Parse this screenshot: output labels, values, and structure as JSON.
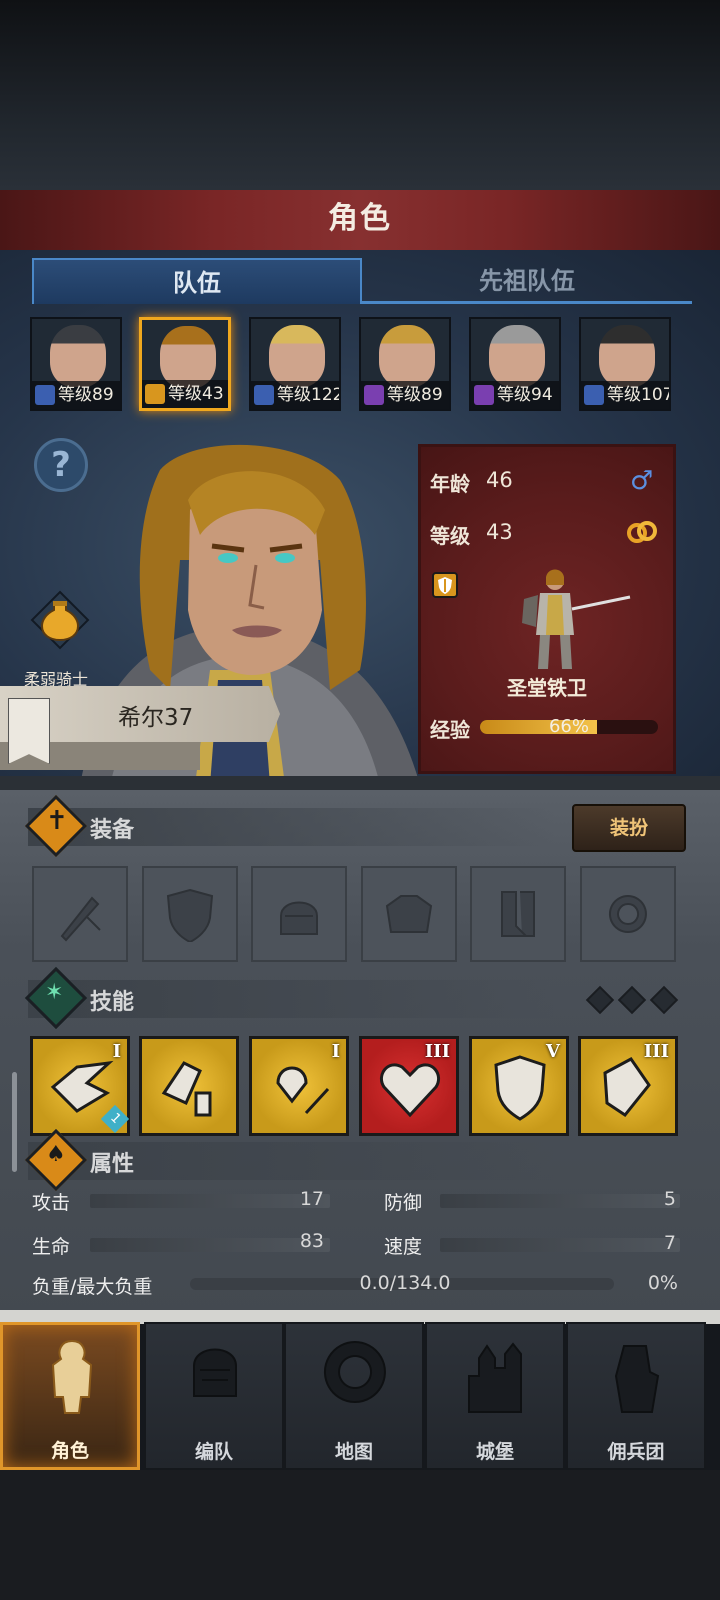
{
  "header": {
    "title": "角色"
  },
  "tabs": [
    {
      "label": "队伍",
      "active": true
    },
    {
      "label": "先祖队伍",
      "active": false
    }
  ],
  "roster": [
    {
      "level": "等级89",
      "class_icon": "sword-icon",
      "class_color": "#3b5fb0",
      "hair": "#3a3d42"
    },
    {
      "level": "等级43",
      "class_icon": "shield-icon",
      "class_color": "#d8961e",
      "hair": "#a8701c",
      "selected": true
    },
    {
      "level": "等级122",
      "class_icon": "sword-icon",
      "class_color": "#3b5fb0",
      "hair": "#d8b85c"
    },
    {
      "level": "等级89",
      "class_icon": "staff-icon",
      "class_color": "#7a3fb0",
      "hair": "#c89c3c"
    },
    {
      "level": "等级94",
      "class_icon": "staff-icon",
      "class_color": "#7a3fb0",
      "hair": "#9a9a9a"
    },
    {
      "level": "等级107",
      "class_icon": "sword-icon",
      "class_color": "#3b5fb0",
      "hair": "#2e2e2e"
    }
  ],
  "hero": {
    "trait": "柔弱骑士",
    "name": "希尔37",
    "age_label": "年龄",
    "age": "46",
    "level_label": "等级",
    "level": "43",
    "role": "圣堂铁卫",
    "exp_label": "经验",
    "exp_text": "66%",
    "exp_fraction": 0.66
  },
  "equipment": {
    "title": "装备",
    "outfit_button": "装扮",
    "slots": [
      "sword-slot-icon",
      "shield-slot-icon",
      "helmet-slot-icon",
      "armor-slot-icon",
      "boots-slot-icon",
      "ring-slot-icon"
    ]
  },
  "skills": {
    "title": "技能",
    "items": [
      {
        "rank": "I",
        "icon": "strike-icon",
        "bg": "#c89a1a",
        "badge": "1"
      },
      {
        "rank": "",
        "icon": "guard-icon",
        "bg": "#c89a1a"
      },
      {
        "rank": "I",
        "icon": "weaken-icon",
        "bg": "#c89a1a"
      },
      {
        "rank": "III",
        "icon": "heart-icon",
        "bg": "#b41e1e"
      },
      {
        "rank": "V",
        "icon": "shield-icon",
        "bg": "#c89a1a"
      },
      {
        "rank": "III",
        "icon": "shield-bash-icon",
        "bg": "#c89a1a"
      }
    ]
  },
  "attributes": {
    "title": "属性",
    "attack_label": "攻击",
    "attack": "17",
    "defense_label": "防御",
    "defense": "5",
    "hp_label": "生命",
    "hp": "83",
    "speed_label": "速度",
    "speed": "7",
    "load_label": "负重/最大负重",
    "load": "0.0/134.0",
    "load_pct": "0%"
  },
  "nav": [
    {
      "label": "角色",
      "icon": "knight-icon",
      "active": true
    },
    {
      "label": "编队",
      "icon": "helmet-icon"
    },
    {
      "label": "地图",
      "icon": "compass-icon"
    },
    {
      "label": "城堡",
      "icon": "castle-icon"
    },
    {
      "label": "佣兵团",
      "icon": "fist-banner-icon"
    }
  ]
}
